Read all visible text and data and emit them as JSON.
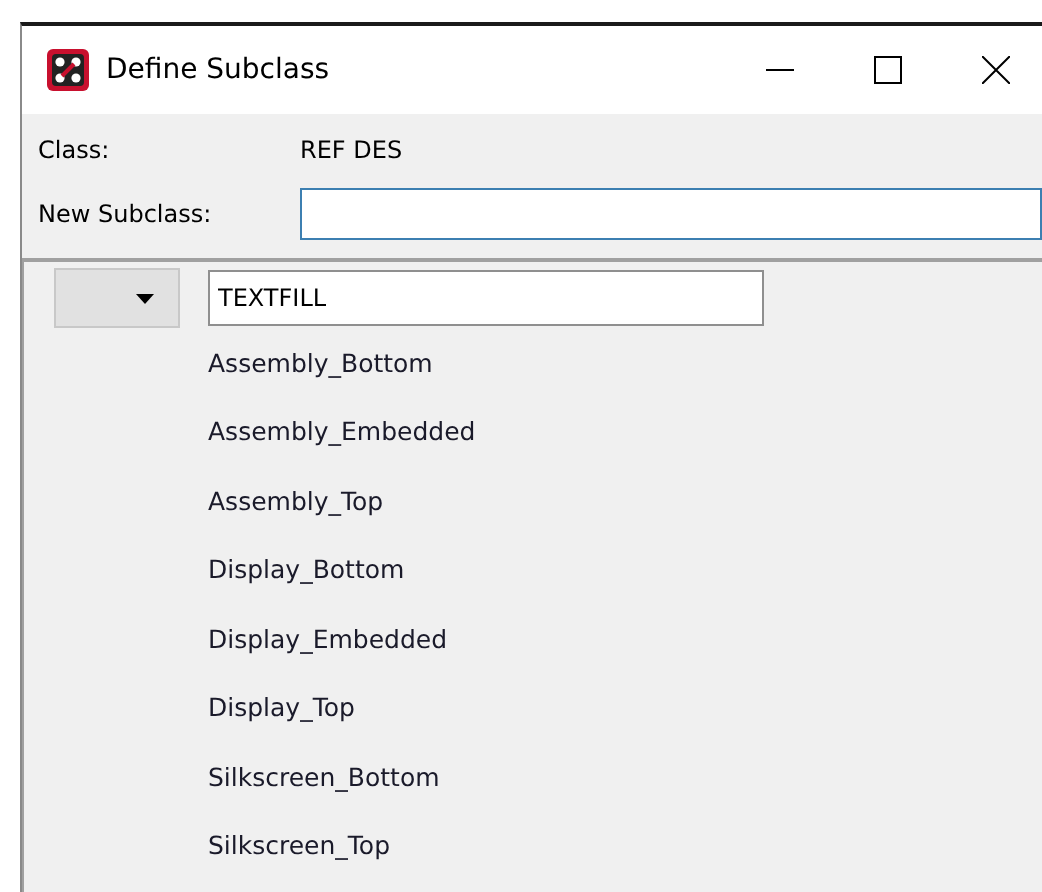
{
  "window": {
    "title": "Define Subclass"
  },
  "class": {
    "label": "Class:",
    "value": "REF DES"
  },
  "new_subclass": {
    "label": "New Subclass:"
  },
  "subclass_row": {
    "value": "TEXTFILL"
  },
  "subclasses": [
    "Assembly_Bottom",
    "Assembly_Embedded",
    "Assembly_Top",
    "Display_Bottom",
    "Display_Embedded",
    "Display_Top",
    "Silkscreen_Bottom",
    "Silkscreen_Top"
  ]
}
